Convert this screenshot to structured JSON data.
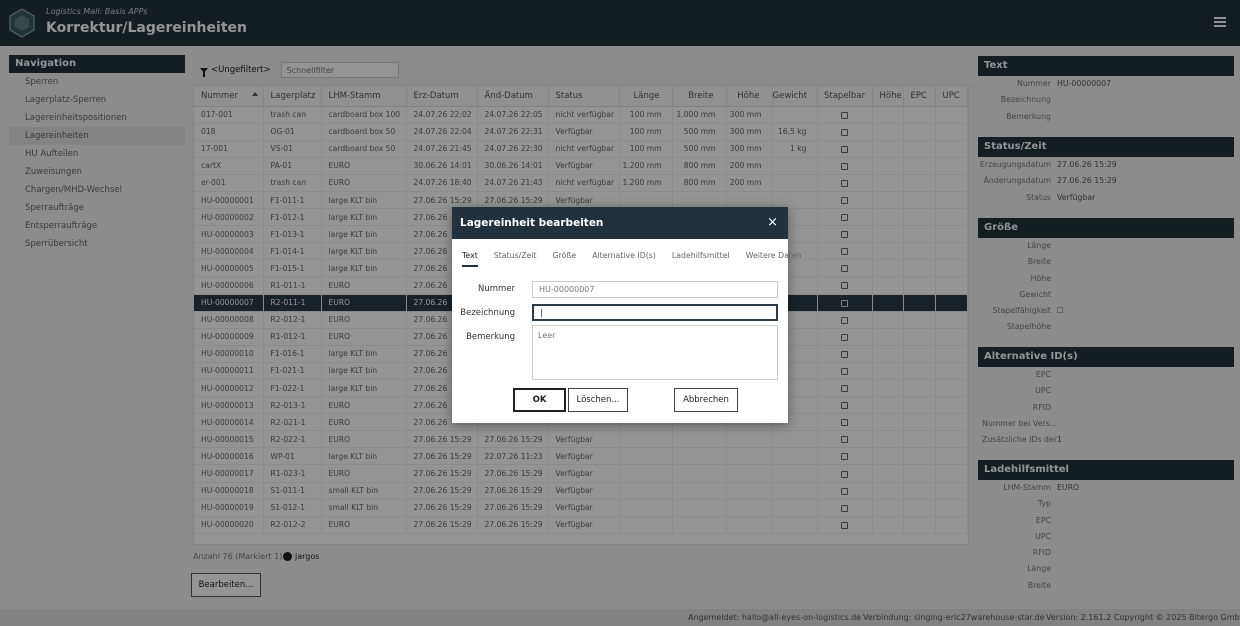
{
  "header": {
    "subtitle": "Logistics Mall: Basis APPs",
    "title": "Korrektur/Lagereinheiten"
  },
  "nav": {
    "title": "Navigation",
    "items": [
      "Sperren",
      "Lagerplatz-Sperren",
      "Lagereinheitspositionen",
      "Lagereinheiten",
      "HU Aufteilen",
      "Zuweisungen",
      "Chargen/MHD-Wechsel",
      "Sperraufträge",
      "Entsperraufträge",
      "Sperrübersicht"
    ],
    "active_index": 3
  },
  "filter": {
    "label": "<Ungefiltert>",
    "quick_placeholder": "Schnellfilter"
  },
  "table": {
    "columns": [
      "Nummer",
      "Lagerplatz",
      "LHM-Stamm",
      "Erz-Datum",
      "Änd-Datum",
      "Status",
      "Länge",
      "Breite",
      "Höhe",
      "Gewicht",
      "Stapelbar",
      "Höhe",
      "EPC",
      "UPC"
    ],
    "rows": [
      [
        "017-001",
        "trash can",
        "cardboard box 100",
        "24.07.26 22:02",
        "24.07.26 22:05",
        "nicht verfügbar",
        "100 mm",
        "1.000 mm",
        "300 mm",
        ""
      ],
      [
        "018",
        "OG-01",
        "cardboard box 50",
        "24.07.26 22:04",
        "24.07.26 22:31",
        "Verfügbar",
        "100 mm",
        "500 mm",
        "300 mm",
        "16,5 kg"
      ],
      [
        "17-001",
        "VS-01",
        "cardboard box 50",
        "24.07.26 21:45",
        "24.07.26 22:30",
        "nicht verfügbar",
        "100 mm",
        "500 mm",
        "300 mm",
        "1 kg"
      ],
      [
        "cartX",
        "PA-01",
        "EURO",
        "30.06.26 14:01",
        "30.06.26 14:01",
        "Verfügbar",
        "1.200 mm",
        "800 mm",
        "200 mm",
        ""
      ],
      [
        "er-001",
        "trash can",
        "EURO",
        "24.07.26 18:40",
        "24.07.26 21:43",
        "nicht verfügbar",
        "1.200 mm",
        "800 mm",
        "200 mm",
        ""
      ],
      [
        "HU-00000001",
        "F1-011-1",
        "large KLT bin",
        "27.06.26 15:29",
        "27.06.26 15:29",
        "Verfügbar",
        "",
        "",
        "",
        ""
      ],
      [
        "HU-00000002",
        "F1-012-1",
        "large KLT bin",
        "27.06.26",
        "",
        "",
        "",
        "",
        "",
        ""
      ],
      [
        "HU-00000003",
        "F1-013-1",
        "large KLT bin",
        "27.06.26",
        "",
        "",
        "",
        "",
        "",
        ""
      ],
      [
        "HU-00000004",
        "F1-014-1",
        "large KLT bin",
        "27.06.26",
        "",
        "",
        "",
        "",
        "",
        ""
      ],
      [
        "HU-00000005",
        "F1-015-1",
        "large KLT bin",
        "27.06.26",
        "",
        "",
        "",
        "",
        "",
        ""
      ],
      [
        "HU-00000006",
        "R1-011-1",
        "EURO",
        "27.06.26",
        "",
        "",
        "",
        "",
        "",
        ""
      ],
      [
        "HU-00000007",
        "R2-011-1",
        "EURO",
        "27.06.26",
        "",
        "",
        "",
        "",
        "",
        ""
      ],
      [
        "HU-00000008",
        "R2-012-1",
        "EURO",
        "27.06.26",
        "",
        "",
        "",
        "",
        "",
        ""
      ],
      [
        "HU-00000009",
        "R1-012-1",
        "EURO",
        "27.06.26",
        "",
        "",
        "",
        "",
        "",
        ""
      ],
      [
        "HU-00000010",
        "F1-016-1",
        "large KLT bin",
        "27.06.26",
        "",
        "",
        "",
        "",
        "",
        ""
      ],
      [
        "HU-00000011",
        "F1-021-1",
        "large KLT bin",
        "27.06.26",
        "",
        "",
        "",
        "",
        "",
        ""
      ],
      [
        "HU-00000012",
        "F1-022-1",
        "large KLT bin",
        "27.06.26",
        "",
        "",
        "",
        "",
        "",
        ""
      ],
      [
        "HU-00000013",
        "R2-013-1",
        "EURO",
        "27.06.26",
        "",
        "",
        "",
        "",
        "",
        ""
      ],
      [
        "HU-00000014",
        "R2-021-1",
        "EURO",
        "27.06.26",
        "",
        "",
        "",
        "",
        "",
        ""
      ],
      [
        "HU-00000015",
        "R2-022-1",
        "EURO",
        "27.06.26 15:29",
        "27.06.26 15:29",
        "Verfügbar",
        "",
        "",
        "",
        ""
      ],
      [
        "HU-00000016",
        "WP-01",
        "large KLT bin",
        "27.06.26 15:29",
        "22.07.26 11:23",
        "Verfügbar",
        "",
        "",
        "",
        ""
      ],
      [
        "HU-00000017",
        "R1-023-1",
        "EURO",
        "27.06.26 15:29",
        "27.06.26 15:29",
        "Verfügbar",
        "",
        "",
        "",
        ""
      ],
      [
        "HU-00000018",
        "S1-011-1",
        "small KLT bin",
        "27.06.26 15:29",
        "27.06.26 15:29",
        "Verfügbar",
        "",
        "",
        "",
        ""
      ],
      [
        "HU-00000019",
        "S1-012-1",
        "small KLT bin",
        "27.06.26 15:29",
        "27.06.26 15:29",
        "Verfügbar",
        "",
        "",
        "",
        ""
      ],
      [
        "HU-00000020",
        "R2-012-2",
        "EURO",
        "27.06.26 15:29",
        "27.06.26 15:29",
        "Verfügbar",
        "",
        "",
        "",
        ""
      ]
    ],
    "selected_index": 11,
    "count_text": "Anzahl 76 (Markiert 1)",
    "user": "jargos"
  },
  "edit_button": "Bearbeiten...",
  "right": {
    "sections": [
      {
        "title": "Text",
        "rows": [
          [
            "Nummer",
            "HU-00000007"
          ],
          [
            "Bezeichnung",
            ""
          ],
          [
            "Bemerkung",
            ""
          ]
        ]
      },
      {
        "title": "Status/Zeit",
        "rows": [
          [
            "Erzeugungsdatum",
            "27.06.26 15:29"
          ],
          [
            "Änderungsdatum",
            "27.06.26 15:29"
          ],
          [
            "Status",
            "Verfügbar"
          ]
        ]
      },
      {
        "title": "Größe",
        "rows": [
          [
            "Länge",
            ""
          ],
          [
            "Breite",
            ""
          ],
          [
            "Höhe",
            ""
          ],
          [
            "Gewicht",
            ""
          ],
          [
            "Stapelfähigkeit",
            "☐"
          ],
          [
            "Stapelhöhe",
            ""
          ]
        ]
      },
      {
        "title": "Alternative ID(s)",
        "rows": [
          [
            "EPC",
            ""
          ],
          [
            "UPC",
            ""
          ],
          [
            "RFID",
            ""
          ],
          [
            "Nummer bei Vers...",
            ""
          ],
          [
            "Zusätzliche IDs der...",
            "1"
          ]
        ]
      },
      {
        "title": "Ladehilfsmittel",
        "rows": [
          [
            "LHM-Stamm",
            "EURO"
          ],
          [
            "Typ",
            ""
          ],
          [
            "EPC",
            ""
          ],
          [
            "UPC",
            ""
          ],
          [
            "RFID",
            ""
          ],
          [
            "Länge",
            ""
          ],
          [
            "Breite",
            ""
          ]
        ]
      }
    ]
  },
  "footer": {
    "login": "Angemeldet: hallo@all-eyes-on-logistics.de",
    "connection": "Verbindung: singing-eric27warehouse-star.de",
    "version": "Version: 2.161.2",
    "copyright": "Copyright © 2025 Bitergo GmbH"
  },
  "dialog": {
    "title": "Lagereinheit bearbeiten",
    "close": "×",
    "tabs": [
      "Text",
      "Status/Zeit",
      "Größe",
      "Alternative ID(s)",
      "Ladehilfsmittel",
      "Weitere Daten"
    ],
    "labels": {
      "nummer": "Nummer",
      "bezeichnung": "Bezeichnung",
      "bemerkung": "Bemerkung"
    },
    "values": {
      "nummer": "HU-00000007",
      "bezeichnung": "|",
      "bemerkung_placeholder": "Leer"
    },
    "buttons": {
      "ok": "OK",
      "delete": "Löschen...",
      "cancel": "Abbrechen"
    }
  }
}
